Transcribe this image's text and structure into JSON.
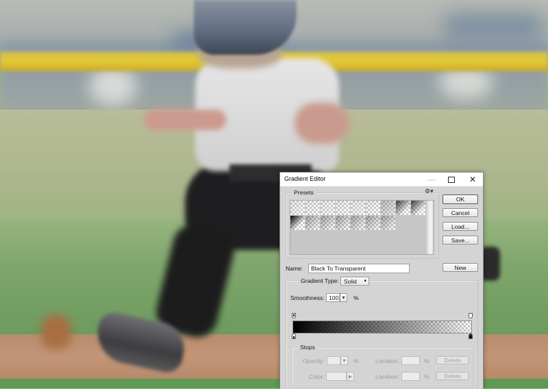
{
  "background": {
    "description": "Blurred photo of a youth baseball player running on a field",
    "colors": {
      "rail": "#e5c935",
      "grass": "#7fa66c",
      "dirt": "#c39577"
    }
  },
  "dialog": {
    "title": "Gradient Editor",
    "titlebar_icons": [
      "minimize-icon",
      "maximize-icon",
      "close-icon"
    ],
    "presets": {
      "label": "Presets",
      "menu_icon": "gear-icon",
      "rows": [
        [
          "checker-light-1",
          "checker-light-2",
          "checker-light-3",
          "checker-light-4",
          "checker-light-5",
          "checker-light-6",
          "checker-mid-1",
          "checker-dark-1",
          "checker-dark-2"
        ],
        [
          "black-to-transparent",
          "checker-diag-1",
          "checker-diag-2",
          "checker-diag-3",
          "checker-diag-4",
          "checker-diag-5",
          "checker-diag-6"
        ]
      ]
    },
    "buttons": {
      "ok": "OK",
      "cancel": "Cancel",
      "load": "Load...",
      "save": "Save...",
      "new": "New"
    },
    "name": {
      "label": "Name:",
      "value": "Black To Transparent"
    },
    "gradient_type": {
      "label": "Gradient Type:",
      "value": "Solid"
    },
    "smoothness": {
      "label": "Smoothness:",
      "value": "100",
      "unit": "%"
    },
    "gradient": {
      "opacity_stops": [
        {
          "location_pct": 0,
          "opacity_pct": 100
        },
        {
          "location_pct": 100,
          "opacity_pct": 0
        }
      ],
      "color_stops": [
        {
          "location_pct": 0,
          "color": "#000000"
        },
        {
          "location_pct": 100,
          "color": "#000000"
        }
      ]
    },
    "stops": {
      "label": "Stops",
      "opacity_label": "Opacity:",
      "color_label": "Color:",
      "location_label": "Location:",
      "percent": "%",
      "delete_label": "Delete",
      "opacity_value": "",
      "opacity_location": "",
      "color_location": ""
    }
  }
}
